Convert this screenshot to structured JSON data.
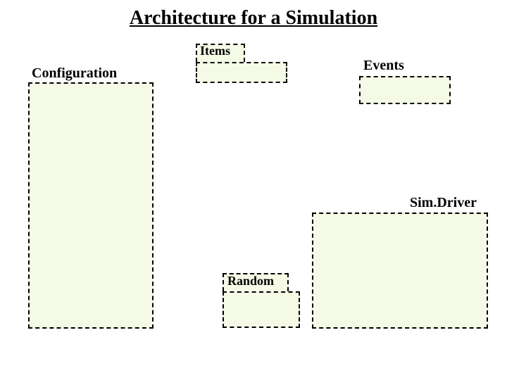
{
  "title": "Architecture for a Simulation",
  "boxes": {
    "configuration": {
      "label": "Configuration"
    },
    "items": {
      "label": "Items"
    },
    "events": {
      "label": "Events"
    },
    "simdriver": {
      "label": "Sim.Driver"
    },
    "random": {
      "label": "Random"
    }
  }
}
